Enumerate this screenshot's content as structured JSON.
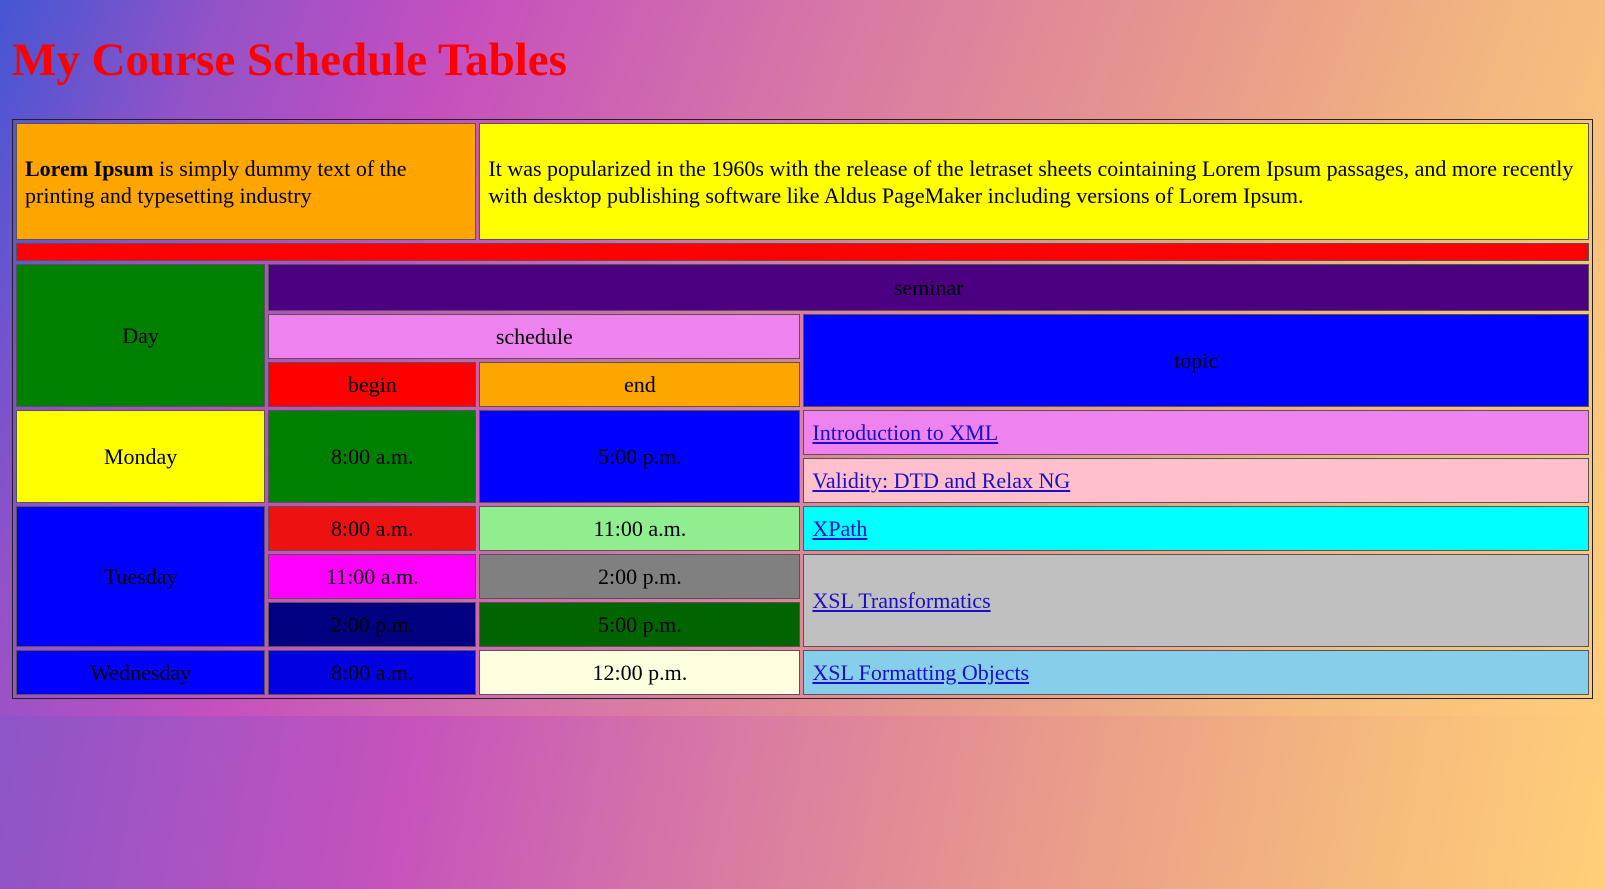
{
  "page": {
    "title": "My Course Schedule Tables"
  },
  "intro": {
    "lead_bold": "Lorem Ipsum",
    "lead_rest": " is simply dummy text of the printing and typesetting industry",
    "history": "It was popularized in the 1960s with the release of the letraset sheets cointaining Lorem Ipsum passages, and more recently with desktop publishing software like Aldus PageMaker including versions of Lorem Ipsum."
  },
  "headers": {
    "day": "Day",
    "seminar": "seminar",
    "schedule": "schedule",
    "topic": "topic",
    "begin": "begin",
    "end": "end"
  },
  "monday": {
    "day": "Monday",
    "begin": "8:00 a.m.",
    "end": "5:00 p.m.",
    "topics": [
      "Introduction to XML",
      "Validity: DTD and Relax NG"
    ]
  },
  "tuesday": {
    "day": "Tuesday",
    "slots": [
      {
        "begin": "8:00 a.m.",
        "end": "11:00 a.m."
      },
      {
        "begin": "11:00 a.m.",
        "end": "2:00 p.m."
      },
      {
        "begin": "2:00 p.m.",
        "end": "5:00 p.m."
      }
    ],
    "topics": [
      "XPath",
      "XSL Transformatics"
    ]
  },
  "wednesday": {
    "day": "Wednesday",
    "begin": "8:00 a.m.",
    "end": "12:00 p.m.",
    "topic": "XSL Formatting Objects"
  },
  "colors": {
    "title": "#ff0000",
    "link": "#1a0dcc",
    "divider": "#ff0000"
  }
}
